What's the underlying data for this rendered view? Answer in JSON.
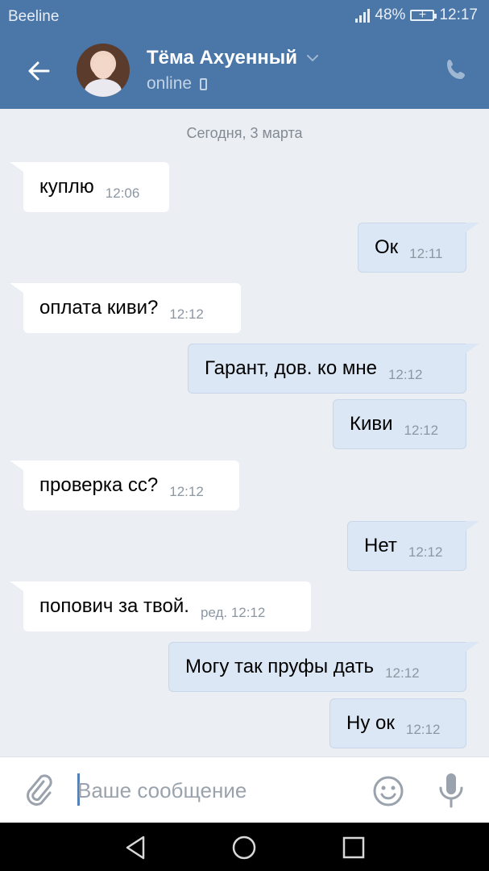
{
  "status_bar": {
    "carrier": "Beeline",
    "battery_pct": "48%",
    "time": "12:17"
  },
  "header": {
    "contact_name": "Тёма Ахуенный",
    "status": "online"
  },
  "chat": {
    "date_divider": "Сегодня, 3 марта",
    "messages": [
      {
        "dir": "in",
        "text": "куплю",
        "time": "12:06"
      },
      {
        "dir": "out",
        "text": "Ок",
        "time": "12:11"
      },
      {
        "dir": "in",
        "text": "оплата киви?",
        "time": "12:12"
      },
      {
        "dir": "out",
        "text": "Гарант, дов. ко мне",
        "time": "12:12"
      },
      {
        "dir": "out",
        "text": "Киви",
        "time": "12:12"
      },
      {
        "dir": "in",
        "text": "проверка сс?",
        "time": "12:12"
      },
      {
        "dir": "out",
        "text": "Нет",
        "time": "12:12"
      },
      {
        "dir": "in",
        "text": "попович за твой.",
        "time": "ред. 12:12"
      },
      {
        "dir": "out",
        "text": "Могу так пруфы дать",
        "time": "12:12"
      },
      {
        "dir": "out",
        "text": "Ну ок",
        "time": "12:12"
      }
    ]
  },
  "composer": {
    "placeholder": "Ваше сообщение"
  },
  "colors": {
    "header_bg": "#4a76a8",
    "chat_bg": "#ebeef2",
    "outgoing_bubble": "#dce7f5",
    "incoming_bubble": "#ffffff"
  }
}
